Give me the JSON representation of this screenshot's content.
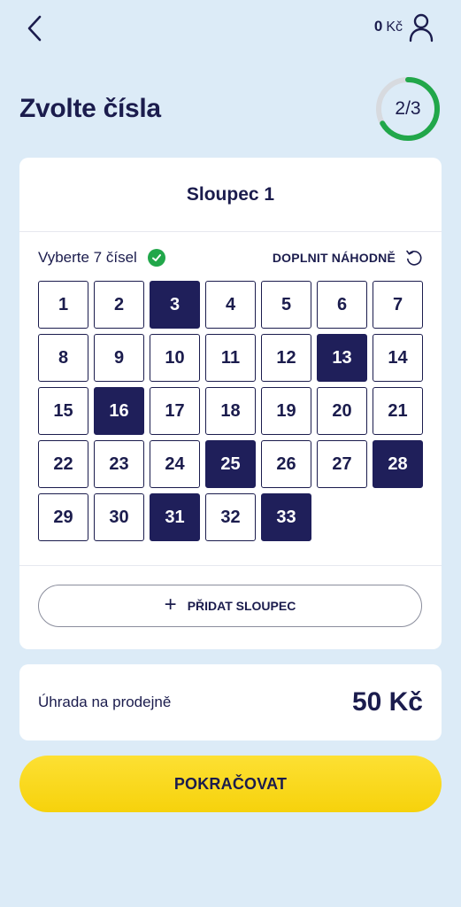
{
  "header": {
    "balance_amount": "0",
    "balance_currency": "Kč"
  },
  "page": {
    "title": "Zvolte čísla",
    "step": "2/3",
    "step_progress": 0.667
  },
  "column": {
    "title": "Sloupec 1",
    "instruction": "Vyberte 7 čísel",
    "random_label": "DOPLNIT NÁHODNĚ",
    "numbers": [
      "1",
      "2",
      "3",
      "4",
      "5",
      "6",
      "7",
      "8",
      "9",
      "10",
      "11",
      "12",
      "13",
      "14",
      "15",
      "16",
      "17",
      "18",
      "19",
      "20",
      "21",
      "22",
      "23",
      "24",
      "25",
      "26",
      "27",
      "28",
      "29",
      "30",
      "31",
      "32",
      "33"
    ],
    "selected": [
      3,
      13,
      16,
      25,
      28,
      31,
      33
    ],
    "add_column_label": "PŘIDAT SLOUPEC"
  },
  "payment": {
    "label": "Úhrada na prodejně",
    "amount": "50 Kč"
  },
  "actions": {
    "continue_label": "POKRAČOVAT"
  },
  "colors": {
    "background": "#dcebf7",
    "navy": "#1b1c4d",
    "selected": "#1f1f5a",
    "progress_green": "#21a74a",
    "progress_track": "#d7dadf",
    "button_yellow": "#fbdb1c"
  },
  "icons": [
    "back-arrow-icon",
    "user-icon",
    "check-circle-icon",
    "refresh-icon",
    "plus-icon"
  ]
}
